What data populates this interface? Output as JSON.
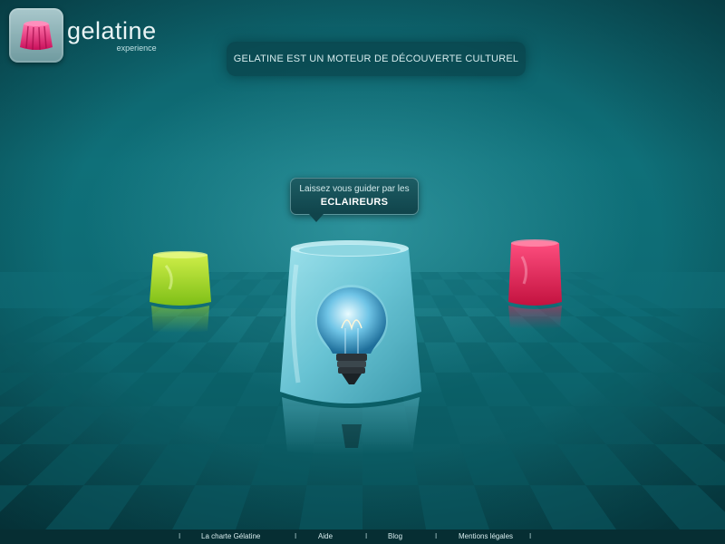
{
  "logo": {
    "name": "gelatine",
    "subtitle": "experience",
    "icon": "jelly-mold-icon"
  },
  "tagline": "GELATINE EST  UN MOTEUR DE DÉCOUVERTE CULTUREL",
  "tooltip": {
    "line1": "Laissez vous guider par les",
    "line2": "ECLAIREURS"
  },
  "jellies": [
    {
      "name": "green-jelly",
      "color": "#a9d62a"
    },
    {
      "name": "blue-jelly-lightbulb",
      "color": "#7fd4e4",
      "icon": "lightbulb-icon"
    },
    {
      "name": "red-jelly",
      "color": "#e0275a"
    }
  ],
  "footer": {
    "separator": "I",
    "links": [
      "La charte Gélatine",
      "Aide",
      "Blog",
      "Mentions légales"
    ]
  },
  "colors": {
    "background": "#0f7079",
    "brand_pink": "#e8347a",
    "footer_bg": "#062e33"
  }
}
